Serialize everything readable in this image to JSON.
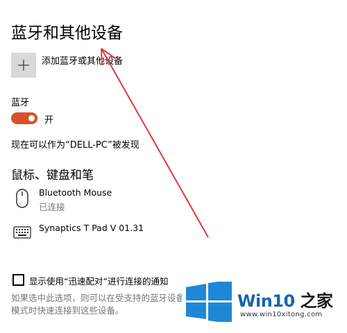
{
  "page": {
    "title": "蓝牙和其他设备"
  },
  "add_device": {
    "label": "添加蓝牙或其他设备"
  },
  "bluetooth": {
    "heading": "蓝牙",
    "toggle_state": "开",
    "is_on": true,
    "accent_color": "#d9512b",
    "discoverable_text": "现在可以作为“DELL-PC”被发现"
  },
  "mouse_section": {
    "heading": "鼠标、键盘和笔",
    "devices": [
      {
        "name": "Bluetooth Mouse",
        "status": "已连接",
        "icon": "mouse-icon"
      },
      {
        "name": "Synaptics T Pad V 01.31",
        "icon": "keyboard-icon"
      }
    ]
  },
  "swift_pair": {
    "label": "显示使用“迅速配对”进行连接的通知",
    "checked": false,
    "desc_line1": "如果选中此选项，则可以在受支持的蓝牙设备",
    "desc_line2": "模式时快速连接到这些设备。"
  },
  "annotation": {
    "arrow_color": "#e0373f"
  },
  "watermark": {
    "brand_main": "Win10",
    "brand_suffix": "之家",
    "url": "www.win10xitong.com",
    "logo_color": "#1e88d6"
  }
}
